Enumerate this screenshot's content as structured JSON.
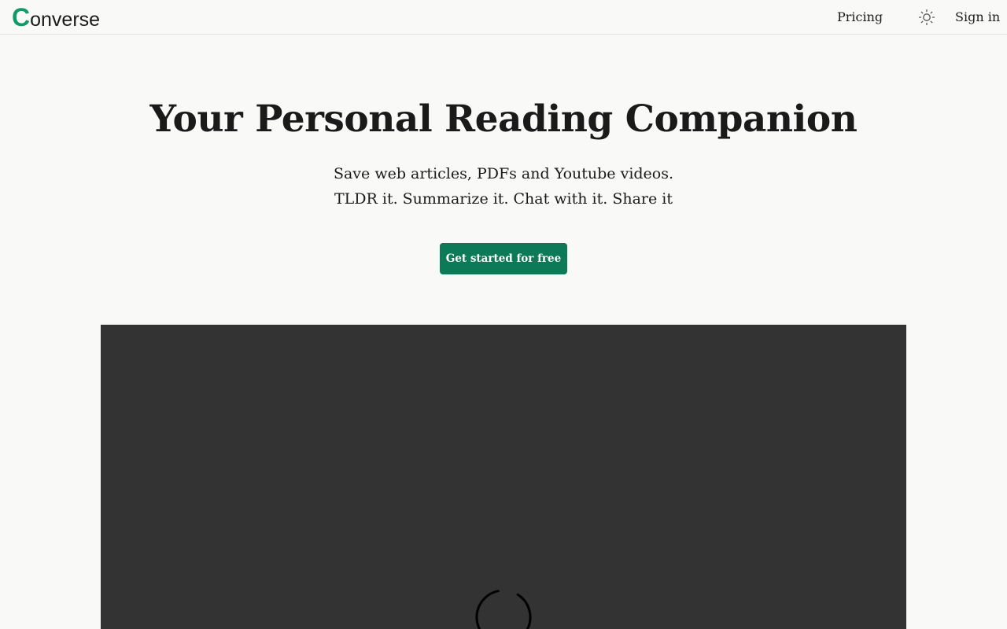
{
  "header": {
    "logo_initial": "C",
    "logo_rest": "onverse",
    "nav": {
      "pricing_label": "Pricing",
      "theme_icon": "sun-icon",
      "signin_label": "Sign in"
    }
  },
  "hero": {
    "title": "Your Personal Reading Companion",
    "subtitle_line1": "Save web articles, PDFs and Youtube videos.",
    "subtitle_line2": "TLDR it. Summarize it. Chat with it. Share it",
    "cta_label": "Get started for free"
  },
  "media": {
    "state_icon": "loading-spinner-icon"
  },
  "colors": {
    "brand_green": "#109a6a",
    "button_green": "#0c7a57",
    "video_bg": "#333333",
    "page_bg": "#f9f9f8"
  }
}
